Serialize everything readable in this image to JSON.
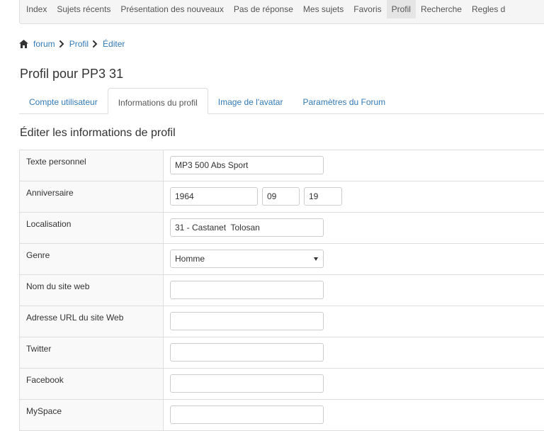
{
  "navbar": {
    "items": [
      {
        "label": "Index"
      },
      {
        "label": "Sujets récents"
      },
      {
        "label": "Présentation des nouveaux"
      },
      {
        "label": "Pas de réponse"
      },
      {
        "label": "Mes sujets"
      },
      {
        "label": "Favoris"
      },
      {
        "label": "Profil",
        "active": true
      },
      {
        "label": "Recherche"
      },
      {
        "label": "Regles d"
      }
    ]
  },
  "breadcrumb": {
    "items": [
      "forum",
      "Profil",
      "Éditer"
    ]
  },
  "page_title": "Profil pour PP3 31",
  "tabs": [
    {
      "label": "Compte utilisateur"
    },
    {
      "label": "Informations du profil",
      "active": true
    },
    {
      "label": "Image de l'avatar"
    },
    {
      "label": "Paramètres du Forum"
    }
  ],
  "section_title": "Éditer les informations de profil",
  "form": {
    "texte_personnel": {
      "label": "Texte personnel",
      "value": "MP3 500 Abs Sport"
    },
    "anniversaire": {
      "label": "Anniversaire",
      "year": "1964",
      "month": "09",
      "day": "19"
    },
    "localisation": {
      "label": "Localisation",
      "value": "31 - Castanet  Tolosan"
    },
    "genre": {
      "label": "Genre",
      "value": "Homme"
    },
    "nom_site_web": {
      "label": "Nom du site web",
      "value": ""
    },
    "url_site_web": {
      "label": "Adresse URL du site Web",
      "value": ""
    },
    "twitter": {
      "label": "Twitter",
      "value": ""
    },
    "facebook": {
      "label": "Facebook",
      "value": ""
    },
    "myspace": {
      "label": "MySpace",
      "value": ""
    }
  },
  "colors": {
    "link": "#337ab7",
    "border": "#dddddd",
    "navbar_bg": "#f5f5f5",
    "label_bg": "#f9f9f9"
  }
}
